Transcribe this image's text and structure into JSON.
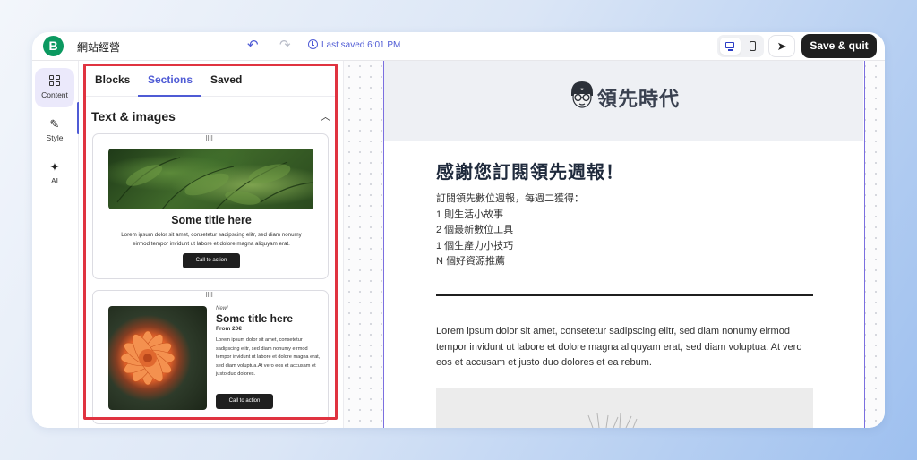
{
  "topbar": {
    "logo_letter": "B",
    "site_name": "網站經營",
    "undo_icon": "undo-arrow-icon",
    "redo_icon": "redo-arrow-icon",
    "last_saved": "Last saved 6:01 PM",
    "device_desktop_icon": "desktop-icon",
    "device_mobile_icon": "mobile-icon",
    "send_icon": "send-icon",
    "save_quit": "Save & quit"
  },
  "rail": {
    "items": [
      {
        "label": "Content",
        "icon": "grid-icon",
        "active": true
      },
      {
        "label": "Style",
        "icon": "brush-icon",
        "active": false
      },
      {
        "label": "AI",
        "icon": "magic-wand-icon",
        "active": false
      }
    ]
  },
  "panel": {
    "tabs": [
      {
        "label": "Blocks",
        "active": false
      },
      {
        "label": "Sections",
        "active": true
      },
      {
        "label": "Saved",
        "active": false
      }
    ],
    "section_title": "Text & images",
    "card1": {
      "title": "Some title here",
      "body": "Lorem ipsum dolor sit amet, consetetur sadipscing elitr, sed diam nonumy eirmod tempor invidunt ut labore et dolore magna aliquyam erat.",
      "button": "Call to action"
    },
    "card2": {
      "tag": "New!",
      "title": "Some title here",
      "price": "From 20€",
      "body": "Lorem ipsum dolor sit amet, consetetur sadipscing elitr, sed diam nonumy eirmod tempor invidunt ut labore et dolore magna erat, sed diam voluptua.At vero eos et accusam et justo duo dolores.",
      "button": "Call to action"
    }
  },
  "email": {
    "brand": "領先時代",
    "title": "感謝您訂閱領先週報！",
    "lines": [
      "訂閱領先數位週報，每週二獲得：",
      "1 則生活小故事",
      "2 個最新數位工具",
      "1 個生產力小技巧",
      "N 個好資源推薦"
    ],
    "paragraph": "Lorem ipsum dolor sit amet, consetetur sadipscing elitr, sed diam nonumy eirmod tempor invidunt ut labore et dolore magna aliquyam erat, sed diam voluptua. At vero eos et accusam et justo duo dolores et ea rebum."
  },
  "colors": {
    "accent": "#4f5bd5",
    "brand_green": "#0b9960",
    "highlight_red": "#e03340",
    "dark_button": "#1f1f1f"
  }
}
